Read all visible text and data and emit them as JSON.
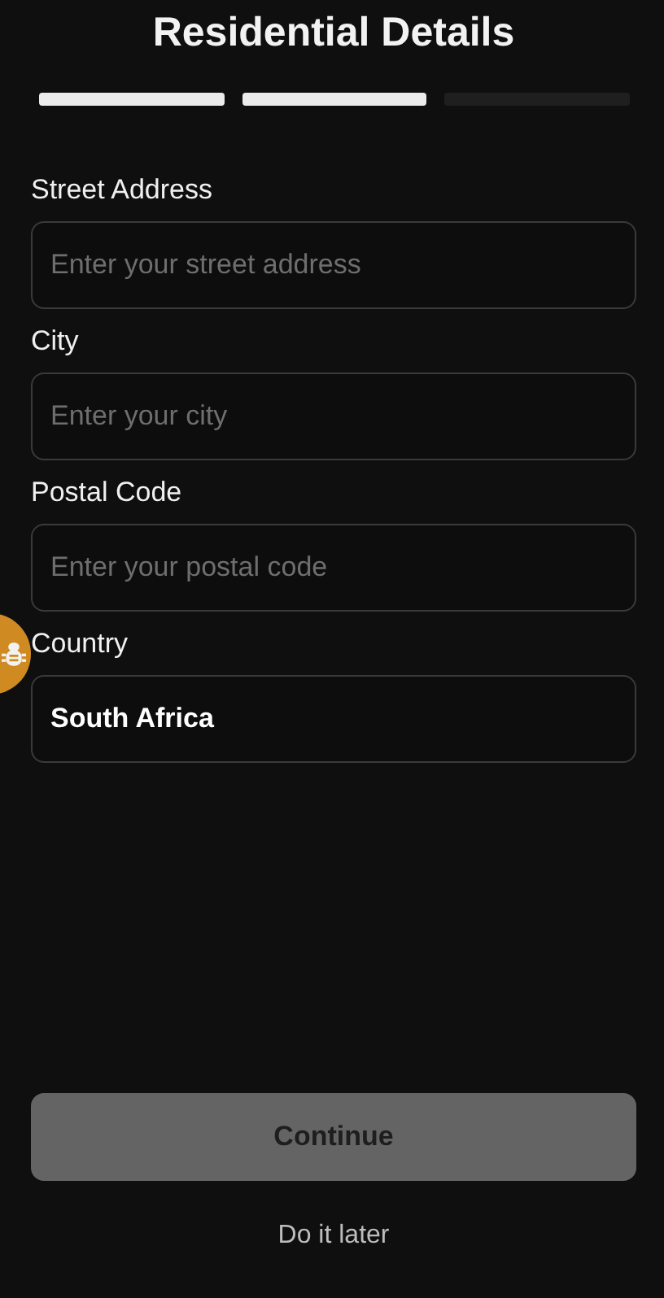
{
  "title": "Residential Details",
  "steps": [
    {
      "done": true
    },
    {
      "done": true
    },
    {
      "done": false
    }
  ],
  "fields": [
    {
      "label": "Street Address",
      "placeholder": "Enter your street address"
    },
    {
      "label": "City",
      "placeholder": "Enter your city"
    },
    {
      "label": "Postal Code",
      "placeholder": "Enter your postal code"
    },
    {
      "label": "Country",
      "value": "South Africa"
    }
  ],
  "continue_button": {
    "label": "Continue",
    "disabled": true
  },
  "skip_link": "Do it later"
}
